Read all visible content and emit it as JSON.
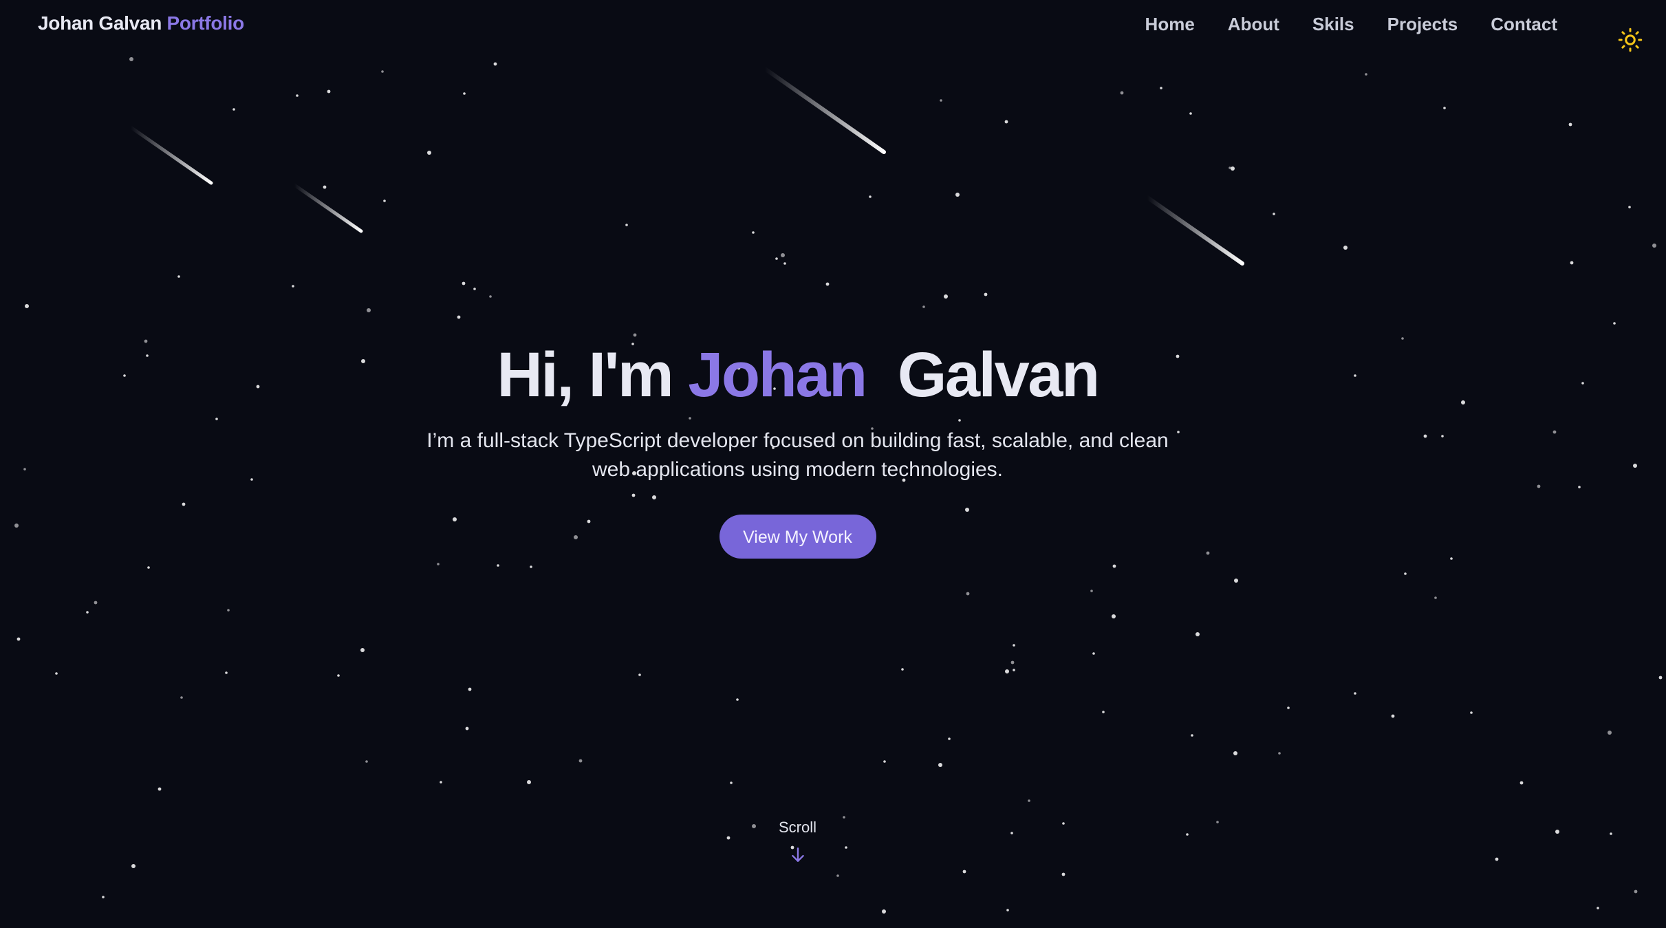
{
  "header": {
    "logo_name": "Johan Galvan",
    "logo_accent": "Portfolio",
    "nav": [
      "Home",
      "About",
      "Skils",
      "Projects",
      "Contact"
    ],
    "theme_icon": "sun-icon"
  },
  "hero": {
    "greeting": "Hi, I'm",
    "first_name": "Johan",
    "last_name": "Galvan",
    "description": "I’m a full-stack TypeScript developer focused on building fast, scalable, and clean web applications using modern technologies.",
    "cta_label": "View My Work"
  },
  "scroll": {
    "label": "Scroll",
    "icon": "arrow-down-icon"
  },
  "colors": {
    "background": "#090b14",
    "accent": "#8b78e6",
    "button": "#7866d9",
    "sun": "#f5c518"
  }
}
